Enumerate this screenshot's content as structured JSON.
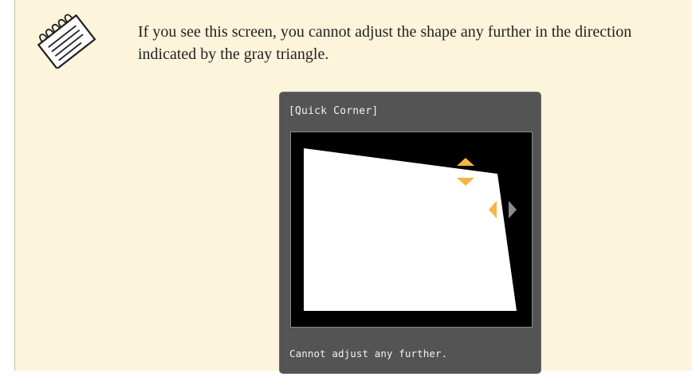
{
  "note": {
    "icon": "note-pad-icon",
    "text": "If you see this screen, you cannot adjust the shape any further in the direction indicated by the gray triangle."
  },
  "osd": {
    "title": "[Quick Corner]",
    "message": "Cannot adjust any further.",
    "indicators": {
      "up": {
        "icon": "triangle-up-icon",
        "color": "#f2b744",
        "state": "active"
      },
      "down": {
        "icon": "triangle-down-icon",
        "color": "#f2b744",
        "state": "active"
      },
      "left": {
        "icon": "triangle-left-icon",
        "color": "#f2b744",
        "state": "active"
      },
      "right": {
        "icon": "triangle-right-icon",
        "color": "#8c8c8c",
        "state": "disabled"
      }
    }
  },
  "colors": {
    "note_background": "#fdf4dc",
    "panel_background": "#545454",
    "active_triangle": "#f2b744",
    "inactive_triangle": "#8c8c8c",
    "projected_image": "#ffffff"
  }
}
